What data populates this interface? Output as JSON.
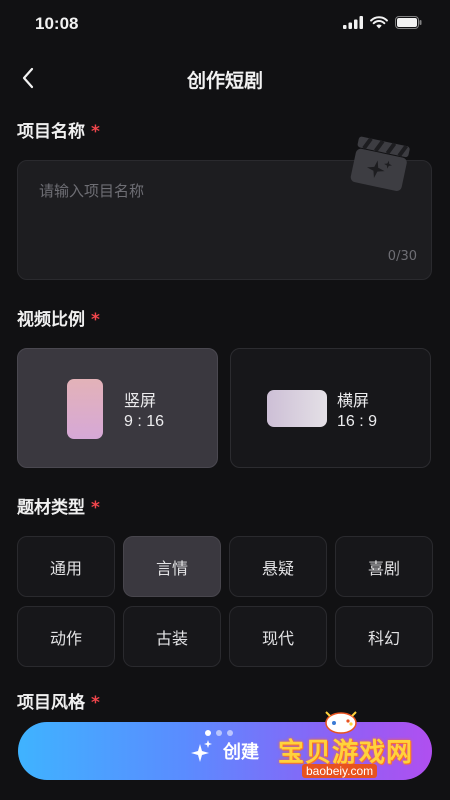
{
  "status": {
    "time": "10:08"
  },
  "nav": {
    "title": "创作短剧"
  },
  "project_name": {
    "label": "项目名称",
    "required_mark": "*",
    "placeholder": "请输入项目名称",
    "count": "0/30"
  },
  "ratio": {
    "label": "视频比例",
    "required_mark": "*",
    "options": [
      {
        "name": "竖屏",
        "value": "9 : 16",
        "selected": true
      },
      {
        "name": "横屏",
        "value": "16 : 9",
        "selected": false
      }
    ]
  },
  "genre": {
    "label": "题材类型",
    "required_mark": "*",
    "options": [
      "通用",
      "言情",
      "悬疑",
      "喜剧",
      "动作",
      "古装",
      "现代",
      "科幻"
    ],
    "selected": "言情"
  },
  "style": {
    "label": "项目风格",
    "required_mark": "*"
  },
  "create_button": {
    "label": "创建"
  },
  "watermark": {
    "title": "宝贝游戏网",
    "url": "baobeiy.com"
  },
  "colors": {
    "accent_required": "#f0464c",
    "selected_bg": "#3a383f"
  }
}
